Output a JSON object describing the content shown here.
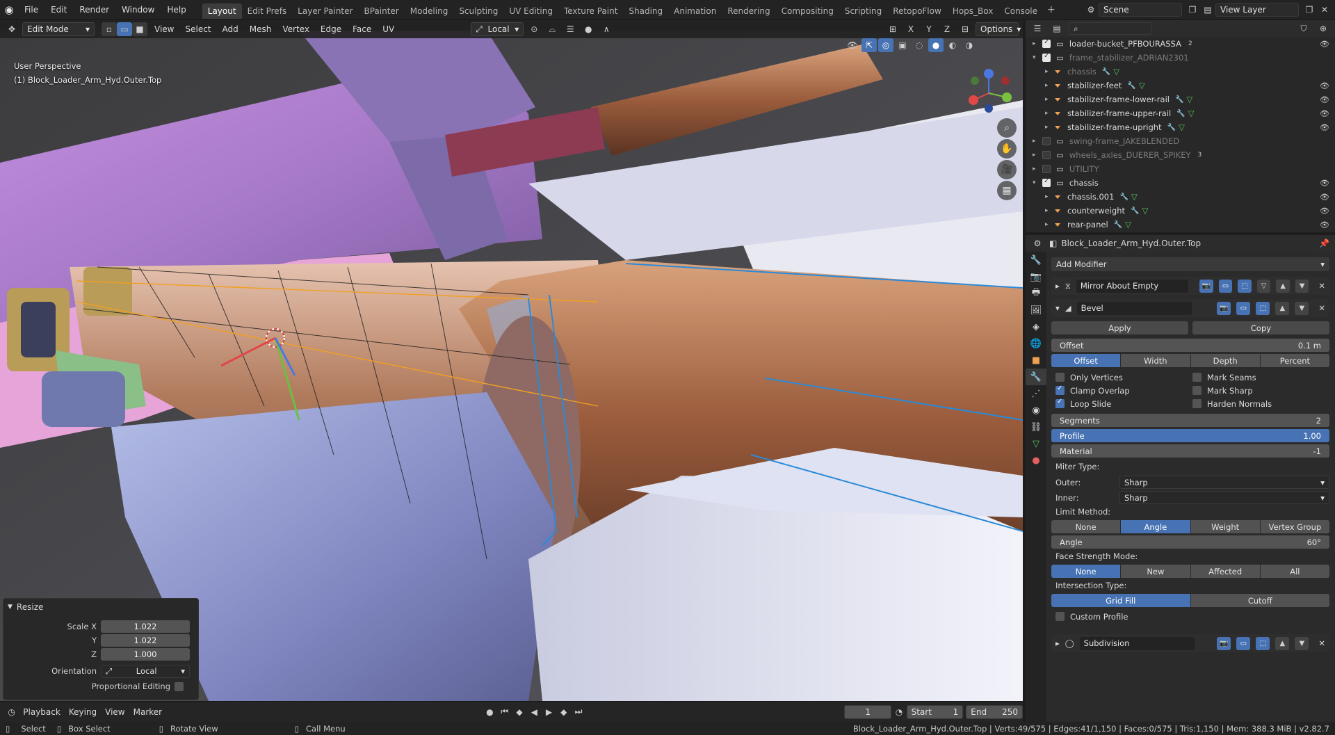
{
  "topbar": {
    "menus": [
      "File",
      "Edit",
      "Render",
      "Window",
      "Help"
    ],
    "tabs": [
      "Layout",
      "Edit Prefs",
      "Layer Painter",
      "BPainter",
      "Modeling",
      "Sculpting",
      "UV Editing",
      "Texture Paint",
      "Shading",
      "Animation",
      "Rendering",
      "Compositing",
      "Scripting",
      "RetopoFlow",
      "Hops_Box",
      "Console"
    ],
    "active_tab": "Layout",
    "scene": "Scene",
    "view_layer": "View Layer"
  },
  "viewport_header": {
    "mode": "Edit Mode",
    "menus": [
      "View",
      "Select",
      "Add",
      "Mesh",
      "Vertex",
      "Edge",
      "Face",
      "UV"
    ],
    "transform_orientation": "Local",
    "axes": [
      "X",
      "Y",
      "Z"
    ],
    "options": "Options"
  },
  "viewport": {
    "perspective": "User Perspective",
    "object": "(1) Block_Loader_Arm_Hyd.Outer.Top"
  },
  "redo_panel": {
    "title": "Resize",
    "scale_x_label": "Scale X",
    "scale_x": "1.022",
    "y_label": "Y",
    "y": "1.022",
    "z_label": "Z",
    "z": "1.000",
    "orientation_label": "Orientation",
    "orientation": "Local",
    "proportional_label": "Proportional Editing"
  },
  "timeline": {
    "menus": [
      "Playback",
      "Keying",
      "View",
      "Marker"
    ],
    "current_frame": "1",
    "start_label": "Start",
    "start": "1",
    "end_label": "End",
    "end": "250"
  },
  "statusbar": {
    "select": "Select",
    "box_select": "Box Select",
    "rotate_view": "Rotate View",
    "call_menu": "Call Menu",
    "info": "Block_Loader_Arm_Hyd.Outer.Top | Verts:49/575 | Edges:41/1,150 | Faces:0/575 | Tris:1,150 | Mem: 388.3 MiB | v2.82.7"
  },
  "outliner": {
    "rows": [
      {
        "name": "loader-bucket_PFBOURASSA",
        "kind": "collection",
        "checked": true,
        "dim": false,
        "badge": "2"
      },
      {
        "name": "frame_stabilizer_ADRIAN2301",
        "kind": "collection",
        "checked": true,
        "dim": true,
        "badge": ""
      },
      {
        "name": "chassis",
        "kind": "object",
        "checked": false,
        "dim": true,
        "badge": ""
      },
      {
        "name": "stabilizer-feet",
        "kind": "object",
        "checked": false,
        "dim": false,
        "badge": ""
      },
      {
        "name": "stabilizer-frame-lower-rail",
        "kind": "object",
        "checked": false,
        "dim": false,
        "badge": ""
      },
      {
        "name": "stabilizer-frame-upper-rail",
        "kind": "object",
        "checked": false,
        "dim": false,
        "badge": ""
      },
      {
        "name": "stabilizer-frame-upright",
        "kind": "object",
        "checked": false,
        "dim": false,
        "badge": ""
      },
      {
        "name": "swing-frame_JAKEBLENDED",
        "kind": "collection",
        "checked": false,
        "dim": true,
        "badge": ""
      },
      {
        "name": "wheels_axles_DUERER_SPIKEY",
        "kind": "collection",
        "checked": false,
        "dim": true,
        "badge": "3"
      },
      {
        "name": "UTILITY",
        "kind": "collection",
        "checked": false,
        "dim": true,
        "badge": ""
      },
      {
        "name": "chassis",
        "kind": "collection",
        "checked": true,
        "dim": false,
        "badge": ""
      },
      {
        "name": "chassis.001",
        "kind": "object",
        "checked": false,
        "dim": false,
        "badge": ""
      },
      {
        "name": "counterweight",
        "kind": "object",
        "checked": false,
        "dim": false,
        "badge": ""
      },
      {
        "name": "rear-panel",
        "kind": "object",
        "checked": false,
        "dim": false,
        "badge": ""
      }
    ]
  },
  "properties": {
    "object_name": "Block_Loader_Arm_Hyd.Outer.Top",
    "add_modifier": "Add Modifier",
    "mirror_name": "Mirror About Empty",
    "bevel_name": "Bevel",
    "apply": "Apply",
    "copy": "Copy",
    "offset_label": "Offset",
    "offset_value": "0.1 m",
    "width_types": [
      "Offset",
      "Width",
      "Depth",
      "Percent"
    ],
    "only_vertices": "Only Vertices",
    "mark_seams": "Mark Seams",
    "clamp_overlap": "Clamp Overlap",
    "mark_sharp": "Mark Sharp",
    "loop_slide": "Loop Slide",
    "harden_normals": "Harden Normals",
    "segments_label": "Segments",
    "segments": "2",
    "profile_label": "Profile",
    "profile": "1.00",
    "material_label": "Material",
    "material": "-1",
    "miter_type": "Miter Type:",
    "outer_label": "Outer:",
    "outer": "Sharp",
    "inner_label": "Inner:",
    "inner": "Sharp",
    "limit_method": "Limit Method:",
    "limit_options": [
      "None",
      "Angle",
      "Weight",
      "Vertex Group"
    ],
    "angle_label": "Angle",
    "angle": "60°",
    "face_strength": "Face Strength Mode:",
    "face_options": [
      "None",
      "New",
      "Affected",
      "All"
    ],
    "intersection": "Intersection Type:",
    "intersection_options": [
      "Grid Fill",
      "Cutoff"
    ],
    "custom_profile": "Custom Profile",
    "subdivision_name": "Subdivision"
  }
}
